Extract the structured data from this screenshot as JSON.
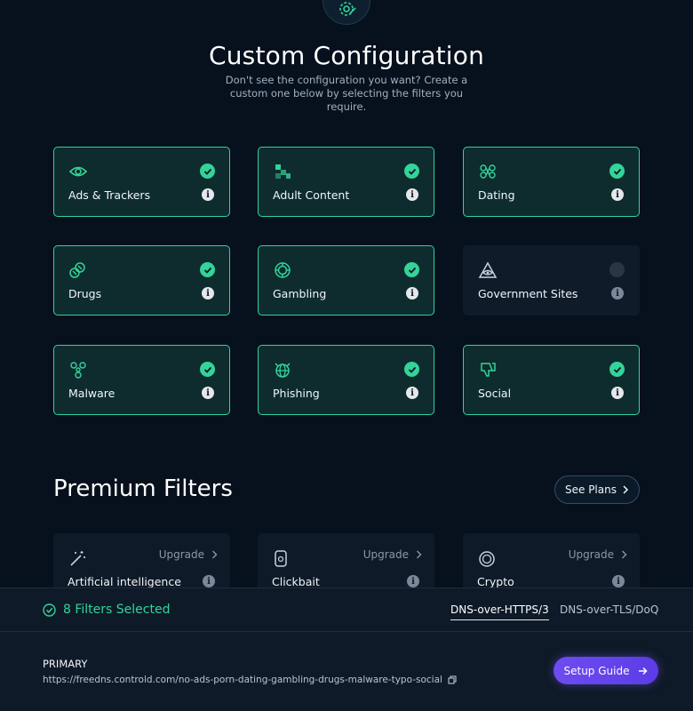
{
  "header": {
    "title": "Custom Configuration",
    "subtitle": "Don't see the configuration you want? Create a custom one below by selecting the filters you require."
  },
  "filters": [
    {
      "label": "Ads & Trackers",
      "icon": "eye-icon",
      "selected": true
    },
    {
      "label": "Adult Content",
      "icon": "squares-icon",
      "selected": true
    },
    {
      "label": "Dating",
      "icon": "dating-icon",
      "selected": true
    },
    {
      "label": "Drugs",
      "icon": "pills-icon",
      "selected": true
    },
    {
      "label": "Gambling",
      "icon": "chip-icon",
      "selected": true
    },
    {
      "label": "Government Sites",
      "icon": "pyramid-eye-icon",
      "selected": false
    },
    {
      "label": "Malware",
      "icon": "biohazard-icon",
      "selected": true
    },
    {
      "label": "Phishing",
      "icon": "globe-icon",
      "selected": true
    },
    {
      "label": "Social",
      "icon": "thumbs-down-icon",
      "selected": true
    }
  ],
  "premium": {
    "title": "Premium Filters",
    "see_plans": "See Plans",
    "items": [
      {
        "label": "Artificial intelligence",
        "icon": "magic-wand-icon",
        "action": "Upgrade"
      },
      {
        "label": "Clickbait",
        "icon": "phone-icon",
        "action": "Upgrade"
      },
      {
        "label": "Crypto",
        "icon": "coin-icon",
        "action": "Upgrade"
      }
    ]
  },
  "footer": {
    "selected_text": "8 Filters Selected",
    "tabs": [
      {
        "label": "DNS-over-HTTPS/3",
        "active": true
      },
      {
        "label": "DNS-over-TLS/DoQ",
        "active": false
      }
    ],
    "primary_label": "PRIMARY",
    "url": "https://freedns.controld.com/no-ads-porn-dating-gambling-drugs-malware-typo-social",
    "setup_button": "Setup Guide"
  },
  "colors": {
    "accent": "#34d399",
    "background": "#07101d",
    "button": "#6d4cf0"
  }
}
